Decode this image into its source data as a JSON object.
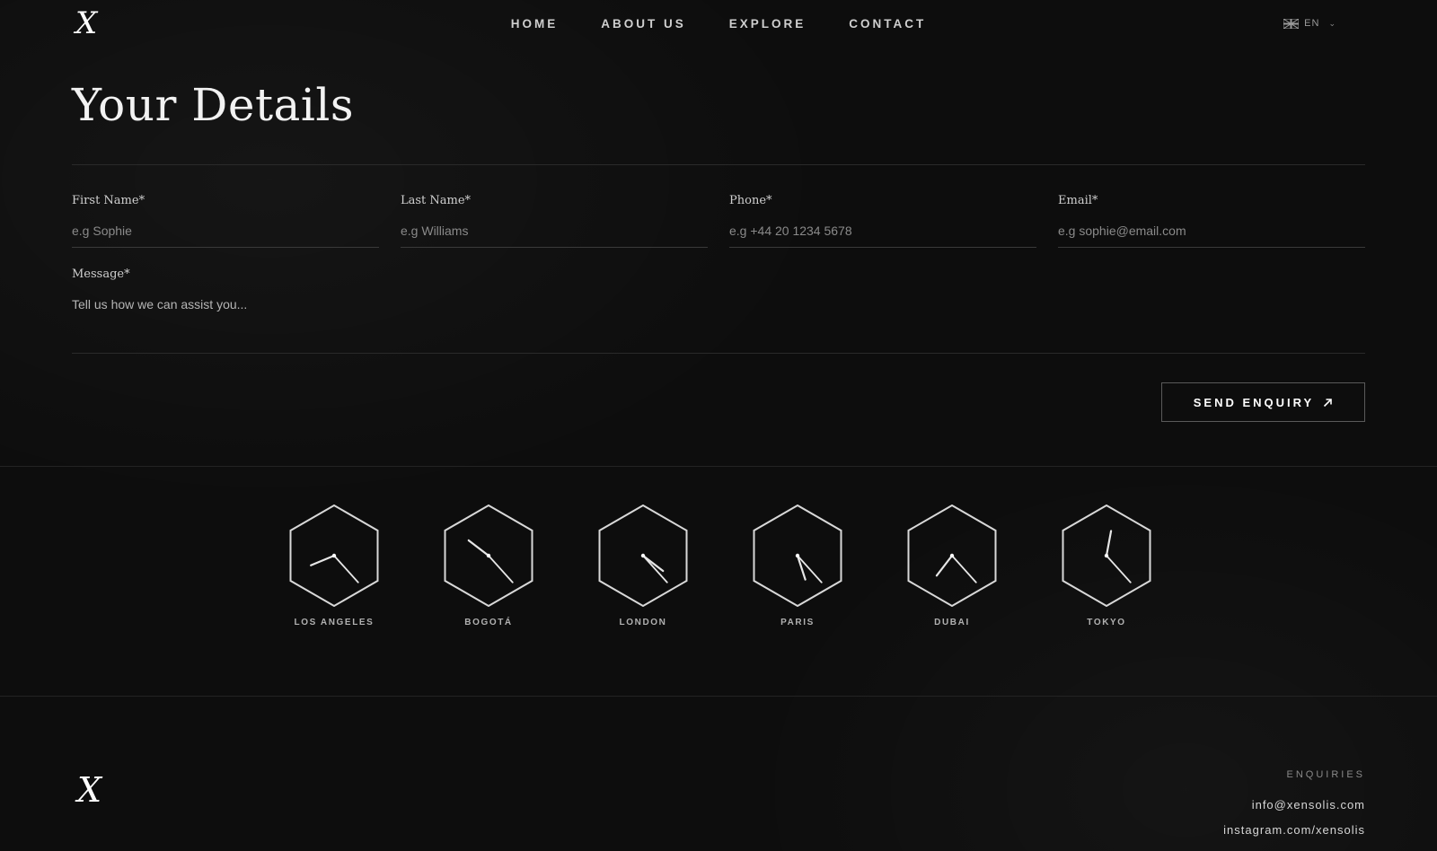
{
  "header": {
    "logo": "X",
    "nav": [
      "HOME",
      "ABOUT US",
      "EXPLORE",
      "CONTACT"
    ],
    "language": "EN"
  },
  "form": {
    "title": "Your Details",
    "first_name": {
      "label": "First Name*",
      "placeholder": "e.g Sophie"
    },
    "last_name": {
      "label": "Last Name*",
      "placeholder": "e.g Williams"
    },
    "phone": {
      "label": "Phone*",
      "placeholder": "e.g +44 20 1234 5678"
    },
    "email": {
      "label": "Email*",
      "placeholder": "e.g sophie@email.com"
    },
    "message": {
      "label": "Message*",
      "placeholder": "Tell us how we can assist you..."
    },
    "submit_label": "SEND ENQUIRY"
  },
  "clocks": [
    {
      "city": "LOS ANGELES",
      "hour": 8.25,
      "minute": 23
    },
    {
      "city": "BOGOTÁ",
      "hour": 10.25,
      "minute": 23
    },
    {
      "city": "LONDON",
      "hour": 4.25,
      "minute": 23
    },
    {
      "city": "PARIS",
      "hour": 5.4,
      "minute": 23
    },
    {
      "city": "DUBAI",
      "hour": 7.25,
      "minute": 23
    },
    {
      "city": "TOKYO",
      "hour": 12.35,
      "minute": 23
    }
  ],
  "footer": {
    "logo": "X",
    "enquiries_label": "ENQUIRIES",
    "email": "info@xensolis.com",
    "instagram": "instagram.com/xensolis"
  },
  "colors": {
    "background": "#0d0d0d",
    "text": "#ffffff",
    "muted": "#8a8a8a",
    "border": "#3a3a3a"
  }
}
